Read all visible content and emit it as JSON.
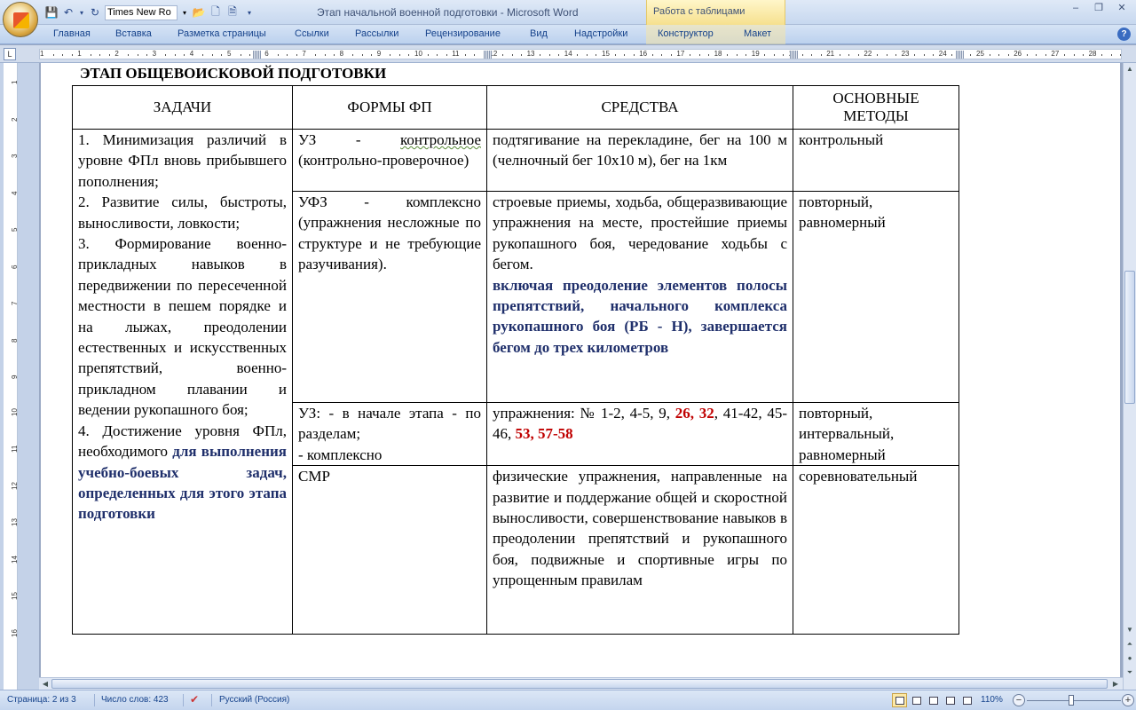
{
  "window": {
    "title": "Этап начальной военной подготовки - Microsoft Word",
    "contextual_tab_group": "Работа с таблицами",
    "font_name": "Times New Ro",
    "controls": [
      "–",
      "❐",
      "✕"
    ]
  },
  "ribbon": {
    "tabs": [
      "Главная",
      "Вставка",
      "Разметка страницы",
      "Ссылки",
      "Рассылки",
      "Рецензирование",
      "Вид",
      "Надстройки",
      "Конструктор",
      "Макет"
    ]
  },
  "ruler": {
    "numbers": [
      "1",
      "1",
      "2",
      "3",
      "4",
      "5",
      "6",
      "7",
      "8",
      "9",
      "10",
      "11",
      "12",
      "13",
      "14",
      "15",
      "16",
      "17",
      "18",
      "19",
      "20",
      "21",
      "22",
      "23",
      "24",
      "25",
      "26",
      "27",
      "28"
    ],
    "vertical_numbers": [
      "1",
      "2",
      "3",
      "4",
      "5",
      "6",
      "7",
      "8",
      "9",
      "10",
      "11",
      "12",
      "13",
      "14",
      "15",
      "16"
    ]
  },
  "document": {
    "heading": "ЭТАП ОБЩЕВОИСКОВОЙ ПОДГОТОВКИ",
    "headers": [
      "ЗАДАЧИ",
      "ФОРМЫ ФП",
      "СРЕДСТВА",
      "ОСНОВНЫЕ МЕТОДЫ"
    ],
    "tasks": {
      "p1": "1. Минимизация различий в уровне ФПл вновь прибывшего пополнения;",
      "p2": "2. Развитие силы, быстроты, выносливости, ловкости;",
      "p3": "3. Формирование военно-прикладных навыков в передвижении по пересеченной местности в пешем порядке и на лыжах, преодолении естественных и искусственных препятствий, военно-прикладном плавании и ведении рукопашного боя;",
      "p4_normal": "4. Достижение уровня ФПл, необходимого ",
      "p4_bold": "для выполнения учебно-боевых задач, определенных для этого этапа подготовки"
    },
    "rows": [
      {
        "form_prefix": "УЗ - ",
        "form_squiggly": "контрольное",
        "form_rest": " (контрольно-проверочное)",
        "means": "подтягивание на перекладине, бег на 100 м (челночный бег 10х10 м), бег на 1км",
        "methods": "контрольный"
      },
      {
        "form": "УФЗ - комплексно (упражнения несложные по структуре и не требующие разучивания).",
        "means": "строевые приемы, ходьба, общеразвивающие упражнения на месте, простейшие приемы рукопашного боя, чередование ходьбы с бегом.",
        "means_bold": "включая преодоление элементов полосы препятствий, начального комплекса рукопашного боя (РБ - Н), завершается бегом до трех километров",
        "methods": "повторный, равномерный"
      },
      {
        "form_line1": "УЗ: - в начале этапа - по разделам;",
        "form_line2": "- комплексно",
        "means_a": "упражнения: № 1-2, 4-5, 9, ",
        "means_red1": "26, 32",
        "means_b": ", 41-42, 45-46, ",
        "means_red2": "53, 57-58",
        "methods": "повторный, интервальный, равномерный"
      },
      {
        "form": "СМР",
        "means": "физические упражнения, направленные на развитие и поддержание общей и скоростной выносливости, совершенствование навыков в преодолении препятствий и рукопашного боя, подвижные и спортивные игры по упрощенным правилам",
        "methods": "соревновательный"
      }
    ]
  },
  "statusbar": {
    "page": "Страница: 2 из 3",
    "words": "Число слов: 423",
    "language": "Русский (Россия)",
    "zoom": "110%"
  }
}
